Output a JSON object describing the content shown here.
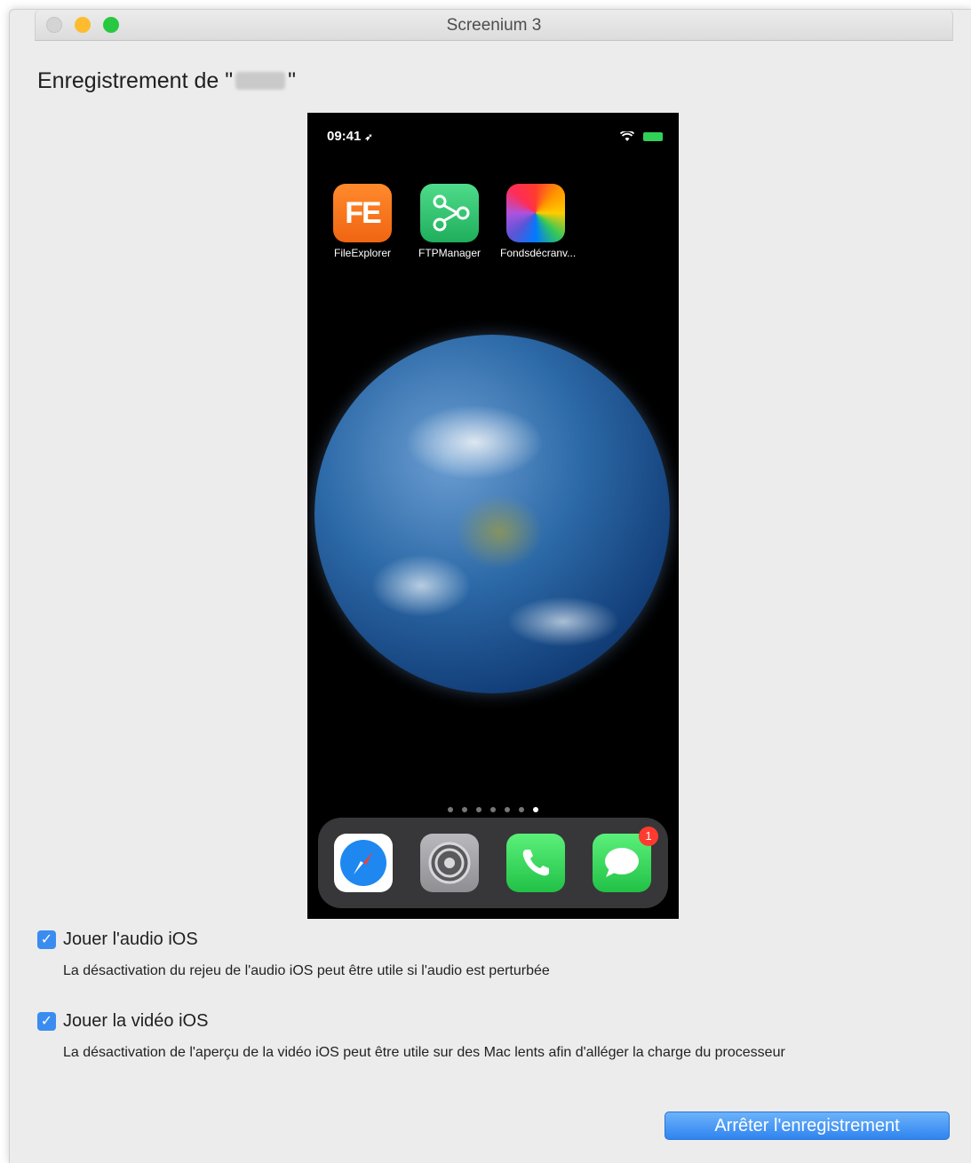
{
  "window": {
    "title": "Screenium 3"
  },
  "recording": {
    "heading_prefix": "Enregistrement de \"",
    "heading_suffix": "\""
  },
  "phone": {
    "status_time": "09:41",
    "status_arrow": "➶",
    "apps": [
      {
        "label": "FileExplorer",
        "icon_text": "FE",
        "color": "#f47320"
      },
      {
        "label": "FTPManager",
        "icon_text": "",
        "color": "#2dc46a"
      },
      {
        "label": "Fondsdécranv...",
        "icon_text": "",
        "color": "#ff3b30"
      }
    ],
    "page_dots_total": 7,
    "page_dots_active_index": 6,
    "dock": {
      "apps": [
        "safari-icon",
        "settings-icon",
        "phone-icon",
        "messages-icon"
      ],
      "messages_badge": "1"
    }
  },
  "options": {
    "audio": {
      "checked": true,
      "label": "Jouer l'audio iOS",
      "description": "La désactivation du rejeu de l'audio iOS peut être utile si l'audio est perturbée"
    },
    "video": {
      "checked": true,
      "label": "Jouer la vidéo iOS",
      "description": "La désactivation de l'aperçu de la vidéo iOS peut être utile sur des Mac lents afin d'alléger la charge du processeur"
    }
  },
  "actions": {
    "stop_label": "Arrêter l'enregistrement"
  },
  "colors": {
    "accent": "#3b8cf0",
    "window_bg": "#ececec",
    "close_button": "#d4d4d4",
    "minimize_button": "#fdbc2e",
    "maximize_button": "#28c840",
    "badge": "#ff3b30"
  }
}
